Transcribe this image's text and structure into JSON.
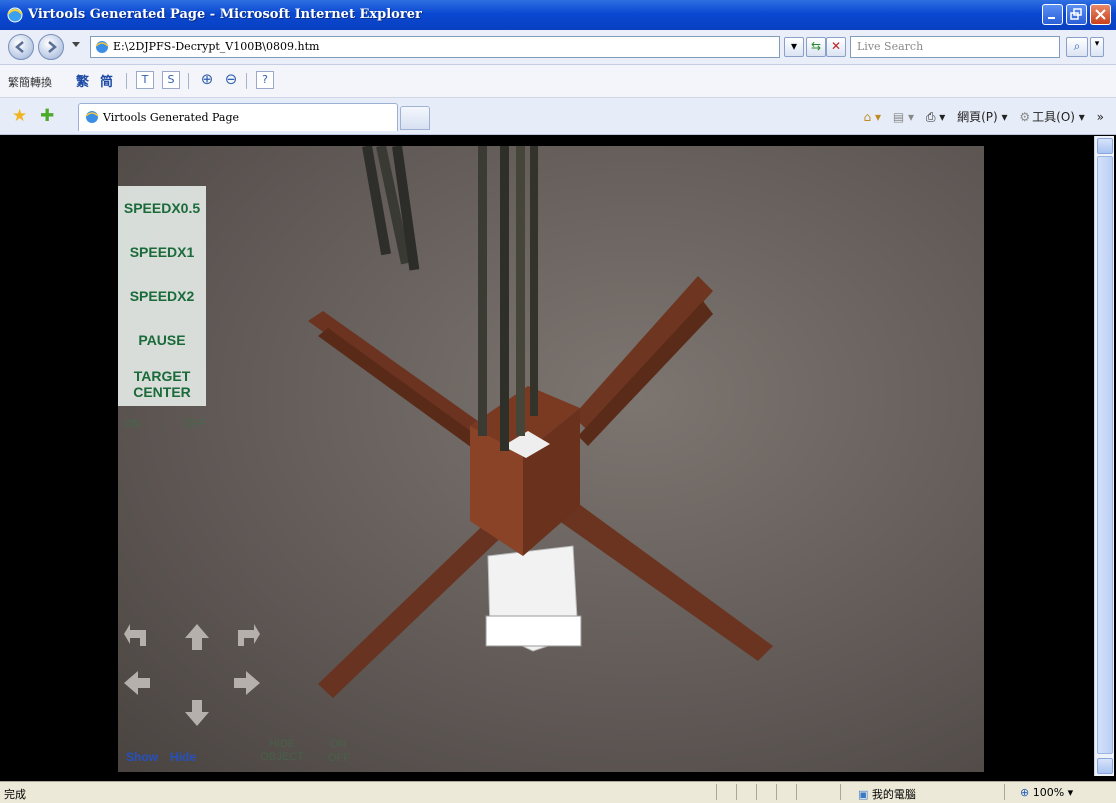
{
  "window": {
    "title": "Virtools Generated Page - Microsoft Internet Explorer",
    "colors": {
      "titlebar": "#0a48d1",
      "close": "#c9401c"
    }
  },
  "addressbar": {
    "url": "E:\\2DJPFS-Decrypt_V100B\\0809.htm",
    "search_placeholder": "Live Search"
  },
  "langbar": {
    "label": "繁簡轉換",
    "trad": "繁",
    "simp": "简"
  },
  "tabbar": {
    "tab_title": "Virtools Generated Page",
    "page_menu": "網頁(P)",
    "tools_menu": "工具(O)",
    "more": "»"
  },
  "scene": {
    "menu": [
      "SPEEDX0.5",
      "SPEEDX1",
      "SPEEDX2",
      "PAUSE",
      "TARGET CENTER"
    ],
    "on_label": "ON",
    "off_label": "OFF",
    "show_label": "Show",
    "hide_label": "Hide",
    "hide_object_label": "HIDE OBJECT",
    "on2_label": "ON",
    "off2_label": "OFF",
    "label_color": "#2550c0"
  },
  "statusbar": {
    "status": "完成",
    "zone": "我的電腦",
    "zoom": "100%"
  }
}
